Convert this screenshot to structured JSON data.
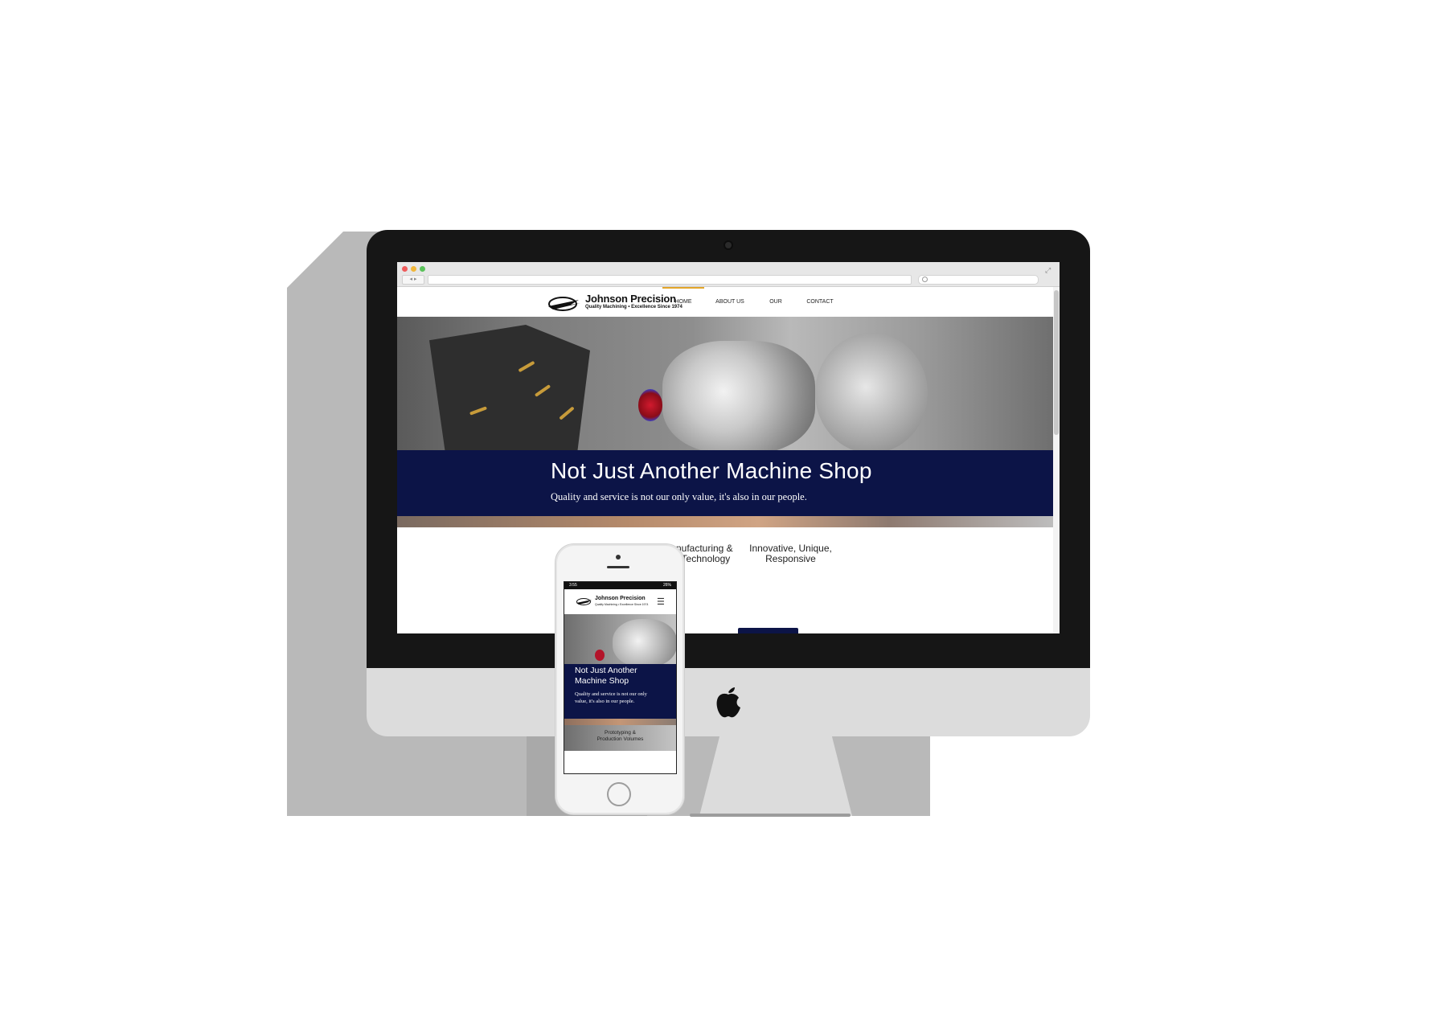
{
  "site": {
    "brand_name": "Johnson Precision",
    "brand_tagline": "Quality Machining • Excellence Since 1974",
    "nav": [
      {
        "label": "HOME",
        "active": true
      },
      {
        "label": "ABOUT US",
        "active": false
      },
      {
        "label": "OUR SERVICES",
        "active": false
      },
      {
        "label": "CONTACT US",
        "active": false
      }
    ],
    "hero_title": "Not Just Another Machine Shop",
    "hero_subtitle": "Quality and service is not our only value, it's also in our people.",
    "features": [
      {
        "line1": "west Manufacturing &",
        "line2": "achining Technology"
      },
      {
        "line1": "Innovative, Unique,",
        "line2": "Responsive"
      }
    ]
  },
  "mobile": {
    "status_time": "3:55",
    "status_battery": "26%",
    "hero_title": "Not Just Another Machine Shop",
    "hero_subtitle": "Quality and service is not our only value, it's also in our people.",
    "feature_line1": "Prototyping &",
    "feature_line2": "Production Volumes"
  },
  "colors": {
    "navy": "#0c1447",
    "accent_gold": "#e3a52a",
    "bezel": "#161616",
    "aluminum": "#dcdcdc"
  },
  "icons": [
    "apple-logo-icon",
    "hamburger-menu-icon",
    "search-icon",
    "fullscreen-icon",
    "johnson-precision-logo-icon"
  ]
}
